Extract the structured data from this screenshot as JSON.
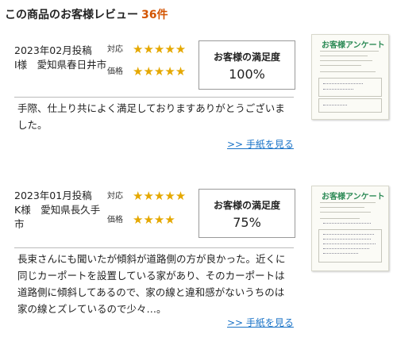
{
  "section": {
    "title": "この商品のお客様レビュー",
    "count": "36件"
  },
  "reviews": [
    {
      "date": "2023年02月投稿",
      "customer": "I様　愛知県春日井市",
      "rating_labels": [
        "対応",
        "価格"
      ],
      "ratings": [
        5,
        5
      ],
      "stars": [
        "★★★★★",
        "★★★★★"
      ],
      "satisfaction_title": "お客様の満足度",
      "satisfaction_value": "100%",
      "comment": "手際、仕上り共によく満足しておりますありがとうございました。",
      "letter_link": ">> 手紙を見る",
      "thumbnail_title": "お客様アンケート"
    },
    {
      "date": "2023年01月投稿",
      "customer": "K様　愛知県長久手市",
      "rating_labels": [
        "対応",
        "価格"
      ],
      "ratings": [
        5,
        4
      ],
      "stars": [
        "★★★★★",
        "★★★★"
      ],
      "satisfaction_title": "お客様の満足度",
      "satisfaction_value": "75%",
      "comment": "長束さんにも聞いたが傾斜が道路側の方が良かった。近くに同じカーポートを設置している家があり、そのカーポートは道路側に傾斜してあるので、家の線と違和感がないうちのは家の線とズレているので少々…。",
      "letter_link": ">> 手紙を見る",
      "thumbnail_title": "お客様アンケート"
    }
  ],
  "colors": {
    "accent": "#d35400",
    "star": "#e5a800",
    "link": "#1a73c7",
    "thumb_title": "#2e8b57"
  }
}
